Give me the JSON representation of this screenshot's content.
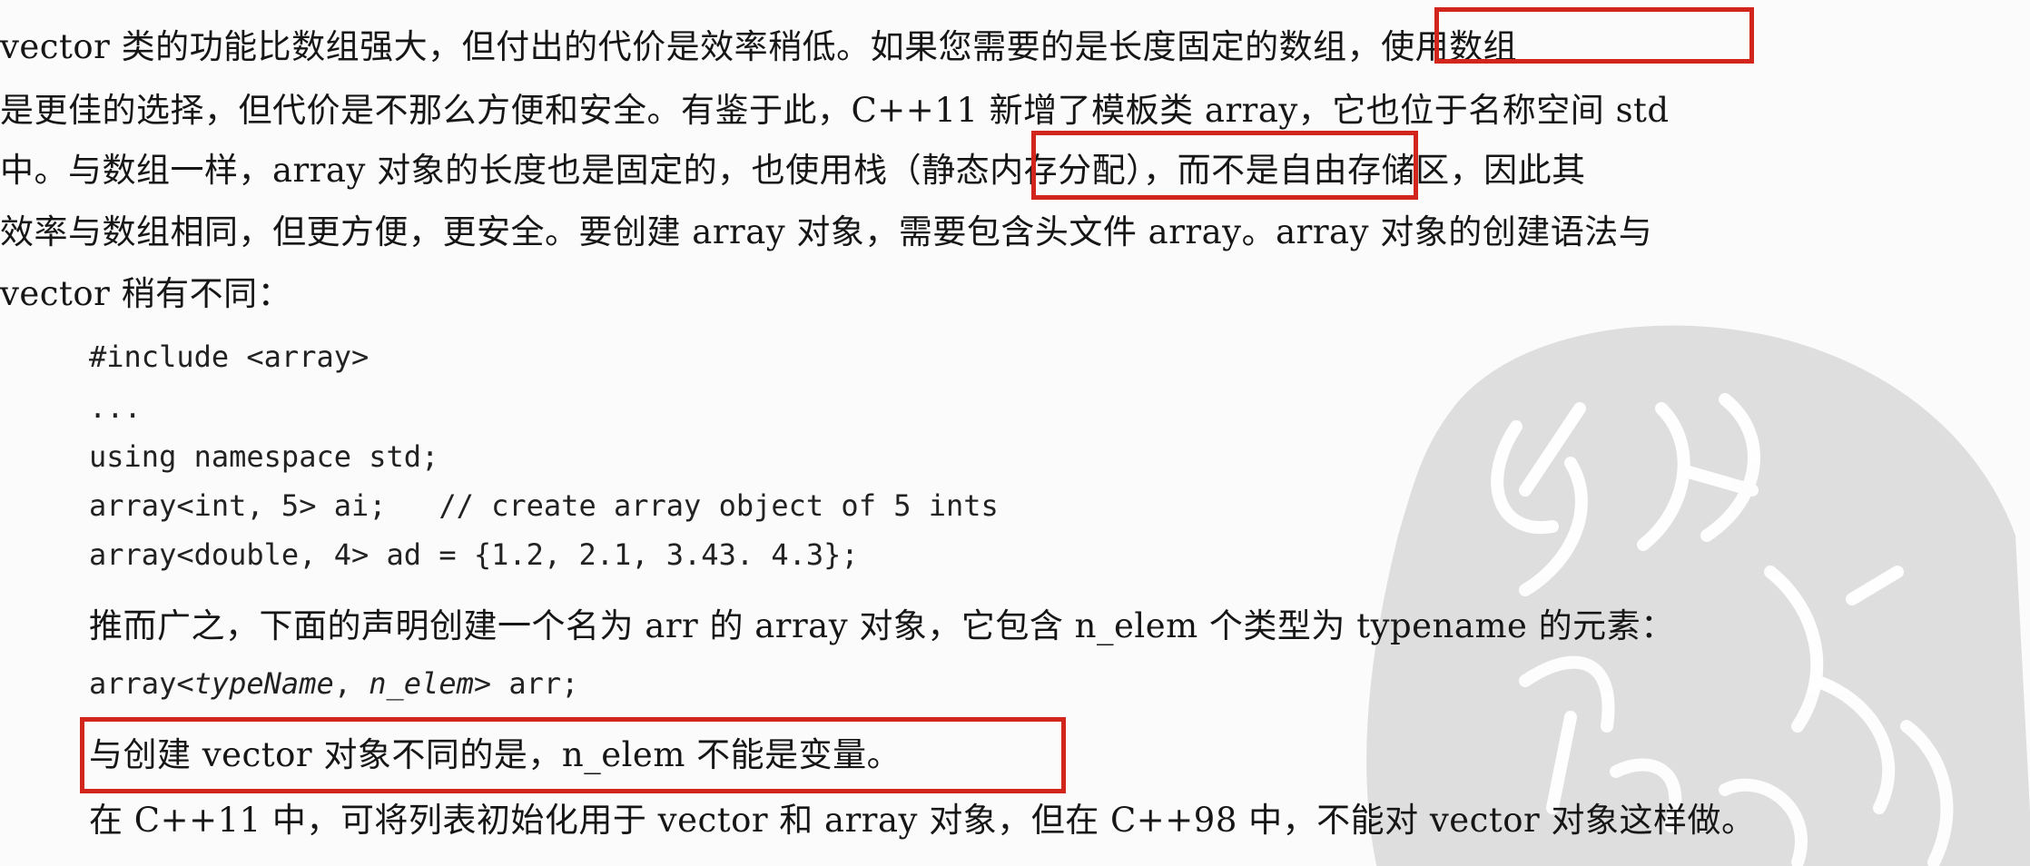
{
  "paragraph1": {
    "line1": "        vector 类的功能比数组强大，但付出的代价是效率稍低。如果您需要的是长度固定的数组，使用数组",
    "line2": "是更佳的选择，但代价是不那么方便和安全。有鉴于此，C++11 新增了模板类 array，它也位于名称空间 std",
    "line3": "中。与数组一样，array 对象的长度也是固定的，也使用栈（静态内存分配），而不是自由存储区，因此其",
    "line4": "效率与数组相同，但更方便，更安全。要创建 array 对象，需要包含头文件 array。array 对象的创建语法与",
    "line5": "vector 稍有不同："
  },
  "code_block": {
    "line1": "#include <array>",
    "line2": "...",
    "line3": "using namespace std;",
    "line4": "array<int, 5> ai;   // create array object of 5 ints",
    "line5": "array<double, 4> ad = {1.2, 2.1, 3.43. 4.3};"
  },
  "paragraph2": "推而广之，下面的声明创建一个名为 arr 的 array 对象，它包含 n_elem 个类型为 typename 的元素：",
  "declaration": {
    "prefix": "array<",
    "type_name": "typeName",
    "sep": ", ",
    "n_elem": "n_elem",
    "suffix": "> arr;"
  },
  "note": "与创建 vector 对象不同的是，n_elem 不能是变量。",
  "paragraph3": "在 C++11 中，可将列表初始化用于 vector 和 array 对象，但在 C++98 中，不能对 vector 对象这样做。",
  "colors": {
    "highlight_border": "#d2261d",
    "text": "#161616",
    "watermark": "#dcdcdc"
  }
}
